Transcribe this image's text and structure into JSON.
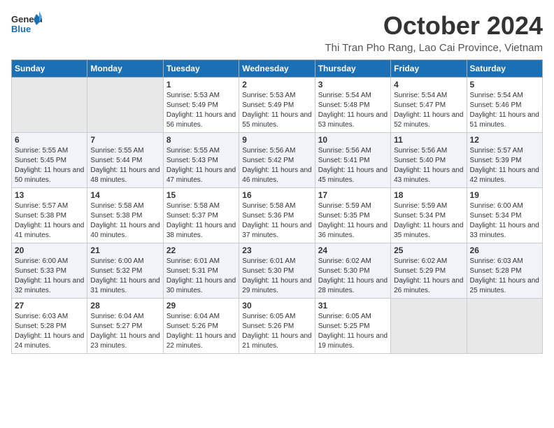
{
  "header": {
    "logo_text_general": "General",
    "logo_text_blue": "Blue",
    "month_title": "October 2024",
    "subtitle": "Thi Tran Pho Rang, Lao Cai Province, Vietnam"
  },
  "weekdays": [
    "Sunday",
    "Monday",
    "Tuesday",
    "Wednesday",
    "Thursday",
    "Friday",
    "Saturday"
  ],
  "weeks": [
    [
      {
        "day": "",
        "sunrise": "",
        "sunset": "",
        "daylight": ""
      },
      {
        "day": "",
        "sunrise": "",
        "sunset": "",
        "daylight": ""
      },
      {
        "day": "1",
        "sunrise": "Sunrise: 5:53 AM",
        "sunset": "Sunset: 5:49 PM",
        "daylight": "Daylight: 11 hours and 56 minutes."
      },
      {
        "day": "2",
        "sunrise": "Sunrise: 5:53 AM",
        "sunset": "Sunset: 5:49 PM",
        "daylight": "Daylight: 11 hours and 55 minutes."
      },
      {
        "day": "3",
        "sunrise": "Sunrise: 5:54 AM",
        "sunset": "Sunset: 5:48 PM",
        "daylight": "Daylight: 11 hours and 53 minutes."
      },
      {
        "day": "4",
        "sunrise": "Sunrise: 5:54 AM",
        "sunset": "Sunset: 5:47 PM",
        "daylight": "Daylight: 11 hours and 52 minutes."
      },
      {
        "day": "5",
        "sunrise": "Sunrise: 5:54 AM",
        "sunset": "Sunset: 5:46 PM",
        "daylight": "Daylight: 11 hours and 51 minutes."
      }
    ],
    [
      {
        "day": "6",
        "sunrise": "Sunrise: 5:55 AM",
        "sunset": "Sunset: 5:45 PM",
        "daylight": "Daylight: 11 hours and 50 minutes."
      },
      {
        "day": "7",
        "sunrise": "Sunrise: 5:55 AM",
        "sunset": "Sunset: 5:44 PM",
        "daylight": "Daylight: 11 hours and 48 minutes."
      },
      {
        "day": "8",
        "sunrise": "Sunrise: 5:55 AM",
        "sunset": "Sunset: 5:43 PM",
        "daylight": "Daylight: 11 hours and 47 minutes."
      },
      {
        "day": "9",
        "sunrise": "Sunrise: 5:56 AM",
        "sunset": "Sunset: 5:42 PM",
        "daylight": "Daylight: 11 hours and 46 minutes."
      },
      {
        "day": "10",
        "sunrise": "Sunrise: 5:56 AM",
        "sunset": "Sunset: 5:41 PM",
        "daylight": "Daylight: 11 hours and 45 minutes."
      },
      {
        "day": "11",
        "sunrise": "Sunrise: 5:56 AM",
        "sunset": "Sunset: 5:40 PM",
        "daylight": "Daylight: 11 hours and 43 minutes."
      },
      {
        "day": "12",
        "sunrise": "Sunrise: 5:57 AM",
        "sunset": "Sunset: 5:39 PM",
        "daylight": "Daylight: 11 hours and 42 minutes."
      }
    ],
    [
      {
        "day": "13",
        "sunrise": "Sunrise: 5:57 AM",
        "sunset": "Sunset: 5:38 PM",
        "daylight": "Daylight: 11 hours and 41 minutes."
      },
      {
        "day": "14",
        "sunrise": "Sunrise: 5:58 AM",
        "sunset": "Sunset: 5:38 PM",
        "daylight": "Daylight: 11 hours and 40 minutes."
      },
      {
        "day": "15",
        "sunrise": "Sunrise: 5:58 AM",
        "sunset": "Sunset: 5:37 PM",
        "daylight": "Daylight: 11 hours and 38 minutes."
      },
      {
        "day": "16",
        "sunrise": "Sunrise: 5:58 AM",
        "sunset": "Sunset: 5:36 PM",
        "daylight": "Daylight: 11 hours and 37 minutes."
      },
      {
        "day": "17",
        "sunrise": "Sunrise: 5:59 AM",
        "sunset": "Sunset: 5:35 PM",
        "daylight": "Daylight: 11 hours and 36 minutes."
      },
      {
        "day": "18",
        "sunrise": "Sunrise: 5:59 AM",
        "sunset": "Sunset: 5:34 PM",
        "daylight": "Daylight: 11 hours and 35 minutes."
      },
      {
        "day": "19",
        "sunrise": "Sunrise: 6:00 AM",
        "sunset": "Sunset: 5:34 PM",
        "daylight": "Daylight: 11 hours and 33 minutes."
      }
    ],
    [
      {
        "day": "20",
        "sunrise": "Sunrise: 6:00 AM",
        "sunset": "Sunset: 5:33 PM",
        "daylight": "Daylight: 11 hours and 32 minutes."
      },
      {
        "day": "21",
        "sunrise": "Sunrise: 6:00 AM",
        "sunset": "Sunset: 5:32 PM",
        "daylight": "Daylight: 11 hours and 31 minutes."
      },
      {
        "day": "22",
        "sunrise": "Sunrise: 6:01 AM",
        "sunset": "Sunset: 5:31 PM",
        "daylight": "Daylight: 11 hours and 30 minutes."
      },
      {
        "day": "23",
        "sunrise": "Sunrise: 6:01 AM",
        "sunset": "Sunset: 5:30 PM",
        "daylight": "Daylight: 11 hours and 29 minutes."
      },
      {
        "day": "24",
        "sunrise": "Sunrise: 6:02 AM",
        "sunset": "Sunset: 5:30 PM",
        "daylight": "Daylight: 11 hours and 28 minutes."
      },
      {
        "day": "25",
        "sunrise": "Sunrise: 6:02 AM",
        "sunset": "Sunset: 5:29 PM",
        "daylight": "Daylight: 11 hours and 26 minutes."
      },
      {
        "day": "26",
        "sunrise": "Sunrise: 6:03 AM",
        "sunset": "Sunset: 5:28 PM",
        "daylight": "Daylight: 11 hours and 25 minutes."
      }
    ],
    [
      {
        "day": "27",
        "sunrise": "Sunrise: 6:03 AM",
        "sunset": "Sunset: 5:28 PM",
        "daylight": "Daylight: 11 hours and 24 minutes."
      },
      {
        "day": "28",
        "sunrise": "Sunrise: 6:04 AM",
        "sunset": "Sunset: 5:27 PM",
        "daylight": "Daylight: 11 hours and 23 minutes."
      },
      {
        "day": "29",
        "sunrise": "Sunrise: 6:04 AM",
        "sunset": "Sunset: 5:26 PM",
        "daylight": "Daylight: 11 hours and 22 minutes."
      },
      {
        "day": "30",
        "sunrise": "Sunrise: 6:05 AM",
        "sunset": "Sunset: 5:26 PM",
        "daylight": "Daylight: 11 hours and 21 minutes."
      },
      {
        "day": "31",
        "sunrise": "Sunrise: 6:05 AM",
        "sunset": "Sunset: 5:25 PM",
        "daylight": "Daylight: 11 hours and 19 minutes."
      },
      {
        "day": "",
        "sunrise": "",
        "sunset": "",
        "daylight": ""
      },
      {
        "day": "",
        "sunrise": "",
        "sunset": "",
        "daylight": ""
      }
    ]
  ]
}
